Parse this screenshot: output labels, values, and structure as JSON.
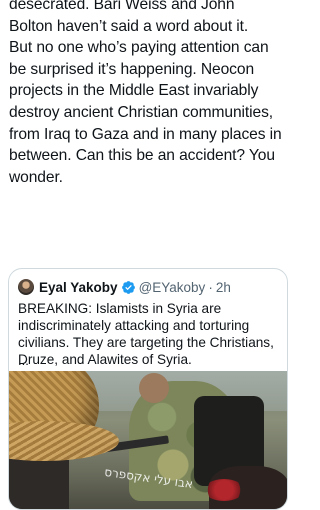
{
  "post": {
    "text": "desecrated. Bari Weiss and John\nBolton haven’t said a word about it.\nBut no one who’s paying attention can\nbe surprised it’s happening. Neocon\nprojects in the Middle East invariably\ndestroy ancient Christian communities,\nfrom Iraq to Gaza and in many places in\nbetween. Can this be an accident? You\nwonder."
  },
  "quote": {
    "author_name": "Eyal Yakoby",
    "handle": "@EYakoby",
    "separator": "·",
    "time": "2h",
    "text": "BREAKING: Islamists in Syria are\nindiscriminately attacking and torturing\ncivilians. They are targeting the Christians,\nDruze, and Alawites of Syria.",
    "truncation": "...",
    "media_watermark": "אבו עלי אקספרס"
  },
  "colors": {
    "text_primary": "#0f1419",
    "text_secondary": "#536471",
    "verified_badge": "#1d9bf0",
    "card_border": "#cfd9de"
  },
  "icons": {
    "verified": "verified-badge-icon"
  }
}
